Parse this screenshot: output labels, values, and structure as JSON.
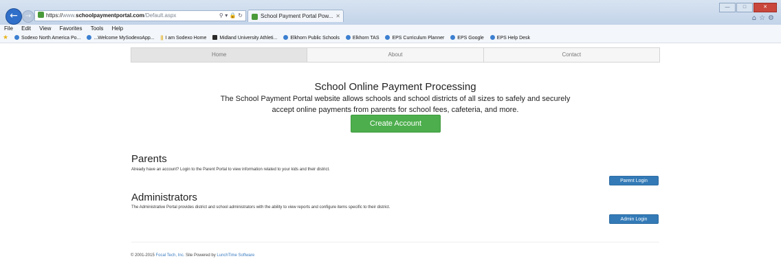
{
  "browser": {
    "url": {
      "scheme": "https://",
      "pre_host": "www.",
      "host": "schoolpaymentportal.com",
      "path": "/Default.aspx"
    },
    "tab_title": "School Payment Portal Pow...",
    "menu": [
      "File",
      "Edit",
      "View",
      "Favorites",
      "Tools",
      "Help"
    ],
    "favorites": [
      "Sodexo North America Po...",
      "...Welcome MySodexoApp...",
      "I am Sodexo Home",
      "Midland University Athleti...",
      "Elkhorn Public Schools",
      "Elkhorn TAS",
      "EPS Curriculum Planner",
      "EPS Google",
      "EPS Help Desk"
    ]
  },
  "nav": {
    "tabs": [
      "Home",
      "About",
      "Contact"
    ]
  },
  "hero": {
    "title": "School Online Payment Processing",
    "description_line1": "The School Payment Portal website allows schools and school districts of all sizes to safely and securely",
    "description_line2": "accept online payments from parents for school fees, cafeteria, and more.",
    "create_button": "Create Account"
  },
  "parents": {
    "title": "Parents",
    "description": "Already have an account? Login to the Parent Portal to view information related to your kids and their district.",
    "button": "Parent Login"
  },
  "administrators": {
    "title": "Administrators",
    "description": "The Administrative Portal provides district and school administrators with the ability to view reports and configure items specific to their district.",
    "button": "Admin Login"
  },
  "footer": {
    "prefix": "© 2001-2015",
    "company": "Focal Tech, Inc.",
    "middle": "Site Powered by",
    "powered": "LunchTime Software"
  },
  "colors": {
    "create_button": "#4cae4c",
    "login_buttons": "#337ab7",
    "footer_links": "#3a7cc0"
  },
  "icons": {
    "back": "back-arrow-icon",
    "favorites": "star-icon",
    "home": "home-icon",
    "settings": "gear-icon"
  }
}
